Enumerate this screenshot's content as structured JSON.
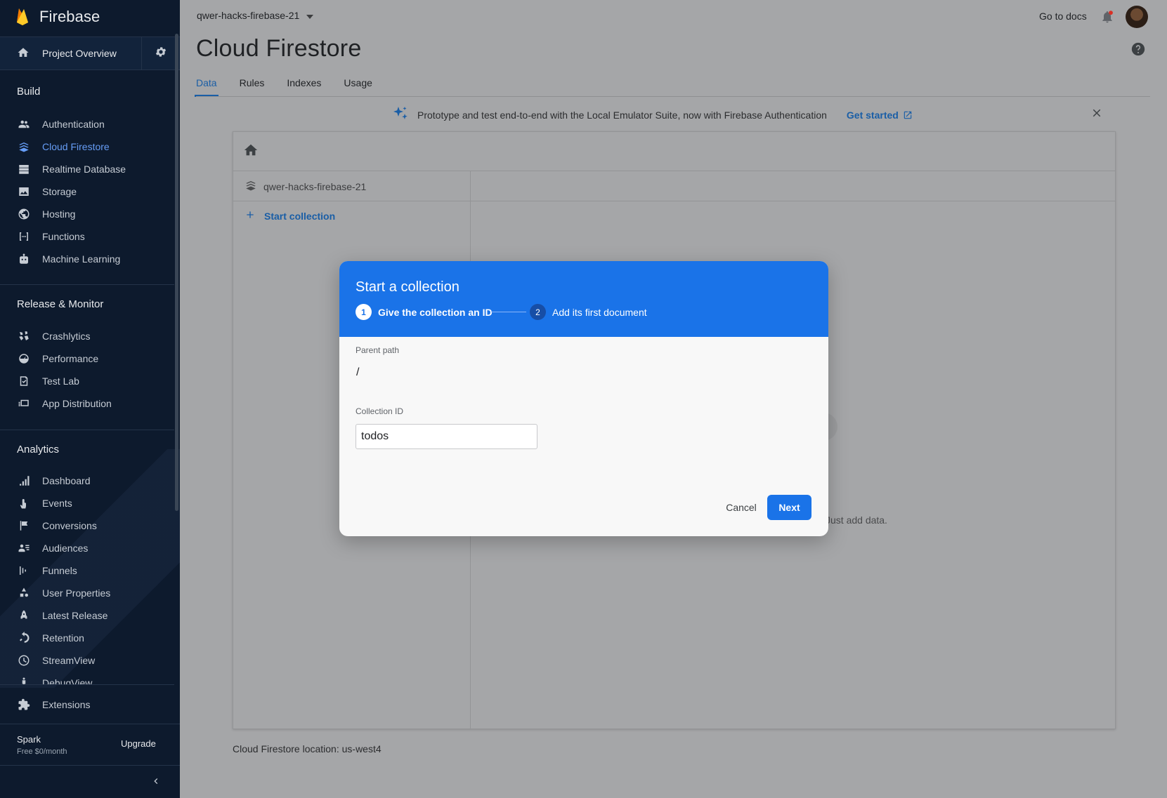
{
  "sidebar": {
    "brand": "Firebase",
    "project_overview": "Project Overview",
    "sections": {
      "build": "Build",
      "release": "Release & Monitor",
      "analytics": "Analytics"
    },
    "build_items": [
      {
        "label": "Authentication",
        "icon": "people-icon"
      },
      {
        "label": "Cloud Firestore",
        "icon": "firestore-icon",
        "active": true
      },
      {
        "label": "Realtime Database",
        "icon": "database-icon"
      },
      {
        "label": "Storage",
        "icon": "image-icon"
      },
      {
        "label": "Hosting",
        "icon": "globe-icon"
      },
      {
        "label": "Functions",
        "icon": "functions-icon"
      },
      {
        "label": "Machine Learning",
        "icon": "robot-icon"
      }
    ],
    "release_items": [
      {
        "label": "Crashlytics",
        "icon": "crashlytics-icon"
      },
      {
        "label": "Performance",
        "icon": "speedometer-icon"
      },
      {
        "label": "Test Lab",
        "icon": "checklist-icon"
      },
      {
        "label": "App Distribution",
        "icon": "app-distribution-icon"
      }
    ],
    "analytics_items": [
      {
        "label": "Dashboard",
        "icon": "bar-chart-icon"
      },
      {
        "label": "Events",
        "icon": "touch-icon"
      },
      {
        "label": "Conversions",
        "icon": "flag-icon"
      },
      {
        "label": "Audiences",
        "icon": "audience-icon"
      },
      {
        "label": "Funnels",
        "icon": "funnel-icon"
      },
      {
        "label": "User Properties",
        "icon": "shapes-icon"
      },
      {
        "label": "Latest Release",
        "icon": "rocket-icon"
      },
      {
        "label": "Retention",
        "icon": "retention-icon"
      },
      {
        "label": "StreamView",
        "icon": "clock-icon"
      },
      {
        "label": "DebugView",
        "icon": "debug-icon"
      }
    ],
    "extensions": "Extensions",
    "plan_name": "Spark",
    "plan_price": "Free $0/month",
    "upgrade": "Upgrade"
  },
  "header": {
    "project": "qwer-hacks-firebase-21",
    "go_to_docs": "Go to docs",
    "title": "Cloud Firestore",
    "tabs": [
      "Data",
      "Rules",
      "Indexes",
      "Usage"
    ]
  },
  "banner": {
    "text": "Prototype and test end-to-end with the Local Emulator Suite, now with Firebase Authentication",
    "link": "Get started"
  },
  "panel": {
    "root": "qwer-hacks-firebase-21",
    "start_collection": "Start collection",
    "empty_text": "Just add data."
  },
  "location": "Cloud Firestore location: us-west4",
  "modal": {
    "title": "Start a collection",
    "step1_num": "1",
    "step1_label": "Give the collection an ID",
    "step2_num": "2",
    "step2_label": "Add its first document",
    "parent_path_label": "Parent path",
    "parent_path_value": "/",
    "collection_id_label": "Collection ID",
    "collection_id_value": "todos",
    "cancel": "Cancel",
    "next": "Next"
  },
  "colors": {
    "sidebar_bg": "#0d1a2d",
    "accent": "#1a73e8",
    "active_nav": "#669df6",
    "overlay_bg": "#a5a6a8"
  }
}
